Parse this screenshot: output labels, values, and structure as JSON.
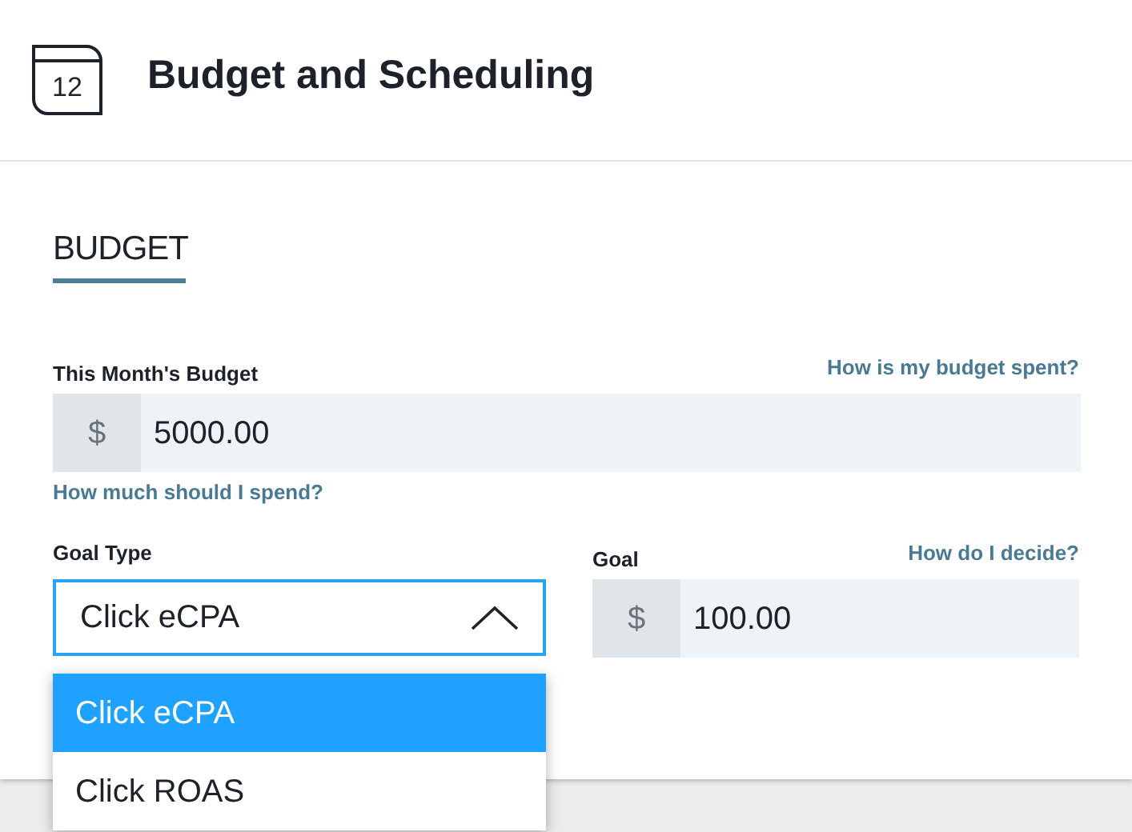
{
  "header": {
    "icon_text": "12",
    "title": "Budget and Scheduling"
  },
  "section": {
    "title": "BUDGET"
  },
  "budget": {
    "label": "This Month's Budget",
    "help_link": "How is my budget spent?",
    "prefix": "$",
    "value": "5000.00",
    "hint_link": "How much should I spend?"
  },
  "goal_type": {
    "label": "Goal Type",
    "value": "Click eCPA",
    "expanded": true,
    "options": [
      {
        "label": "Click eCPA",
        "selected": true
      },
      {
        "label": "Click ROAS",
        "selected": false
      }
    ]
  },
  "goal": {
    "label": "Goal",
    "help_link": "How do I decide?",
    "prefix": "$",
    "value": "100.00"
  }
}
